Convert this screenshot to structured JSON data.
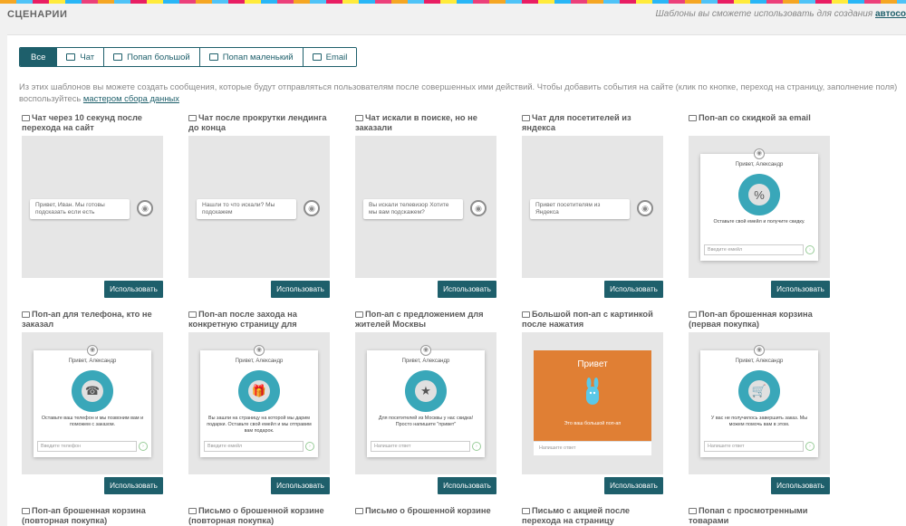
{
  "page": {
    "title": "СЦЕНАРИИ",
    "hint": "Шаблоны вы сможете использовать для создания",
    "hint_link": "автосо"
  },
  "tabs": [
    {
      "label": "Все",
      "icon": "",
      "active": true
    },
    {
      "label": "Чат",
      "icon": "chat-icon",
      "active": false
    },
    {
      "label": "Попап большой",
      "icon": "monitor-icon",
      "active": false
    },
    {
      "label": "Попап маленький",
      "icon": "window-icon",
      "active": false
    },
    {
      "label": "Email",
      "icon": "mail-icon",
      "active": false
    }
  ],
  "description": {
    "text": "Из этих шаблонов вы можете создать сообщения, которые будут отправляться пользователям после совершенных ими действий. Чтобы добавить события на сайте (клик по кнопке, переход на страницу, заполнение поля) воспользуйтесь ",
    "link": "мастером сбора данных"
  },
  "use_label": "Использовать",
  "cards": [
    {
      "title": "Чат через 10 секунд после перехода на сайт",
      "kind": "chat",
      "bubble": "Привет, Иван. Мы готовы подсказать если есть"
    },
    {
      "title": "Чат после прокрутки лендинга до конца",
      "kind": "chat",
      "bubble": "Нашли то что искали? Мы подскажем"
    },
    {
      "title": "Чат искали в поиске, но не заказали",
      "kind": "chat",
      "bubble": "Вы искали телевизор Хотите мы вам подскажем?"
    },
    {
      "title": "Чат для посетителей из яндекса",
      "kind": "chat",
      "bubble": "Привет посетителям из Яндекса"
    },
    {
      "title": "Поп-ап со скидкой за email",
      "kind": "popup",
      "greeting": "Привет, Александр",
      "symbol": "%",
      "text": "Оставьте свой емейл и получите скидку.",
      "input": "Введите емейл"
    },
    {
      "title": "Поп-ап для телефона, кто не заказал",
      "kind": "popup",
      "greeting": "Привет, Александр",
      "symbol": "☎",
      "text": "Оставьте ваш телефон и мы позвоним вам и поможем с заказом.",
      "input": "Введите телефон"
    },
    {
      "title": "Поп-ап после захода на конкретную страницу для",
      "kind": "popup",
      "greeting": "Привет, Александр",
      "symbol": "🎁",
      "text": "Вы зашли на страницу на которой мы дарим подарки. Оставьте свой емейл и мы отправим вам подарок.",
      "input": "Введите емейл"
    },
    {
      "title": "Поп-ап с предложением для жителей Москвы",
      "kind": "popup",
      "greeting": "Привет, Александр",
      "symbol": "★",
      "text": "Для посетителей из Москвы у нас скидка! Просто напишите \"привет\"",
      "input": "Напишите ответ"
    },
    {
      "title": "Большой поп-ап с картинкой после нажатия",
      "kind": "orange",
      "heading": "Привет",
      "text": "Это ваш большой поп-ап",
      "input": "Напишите ответ"
    },
    {
      "title": "Поп-ап брошенная корзина (первая покупка)",
      "kind": "popup",
      "greeting": "Привет, Александр",
      "symbol": "🛒",
      "text": "У вас не получилось завершить заказ. Мы можем помочь вам в этом.",
      "input": "Напишите ответ"
    },
    {
      "title": "Поп-ап брошенная корзина (повторная покупка)",
      "kind": "stub"
    },
    {
      "title": "Письмо о брошенной корзине (повторная покупка)",
      "kind": "stub"
    },
    {
      "title": "Письмо о брошенной корзине",
      "kind": "stub"
    },
    {
      "title": "Письмо с акцией после перехода на страницу",
      "kind": "stub"
    },
    {
      "title": "Попап с просмотренными товарами",
      "kind": "stub"
    }
  ],
  "colors": {
    "accent": "#1e5f6b",
    "circle": "#39a7b9",
    "orange": "#e07f34"
  }
}
